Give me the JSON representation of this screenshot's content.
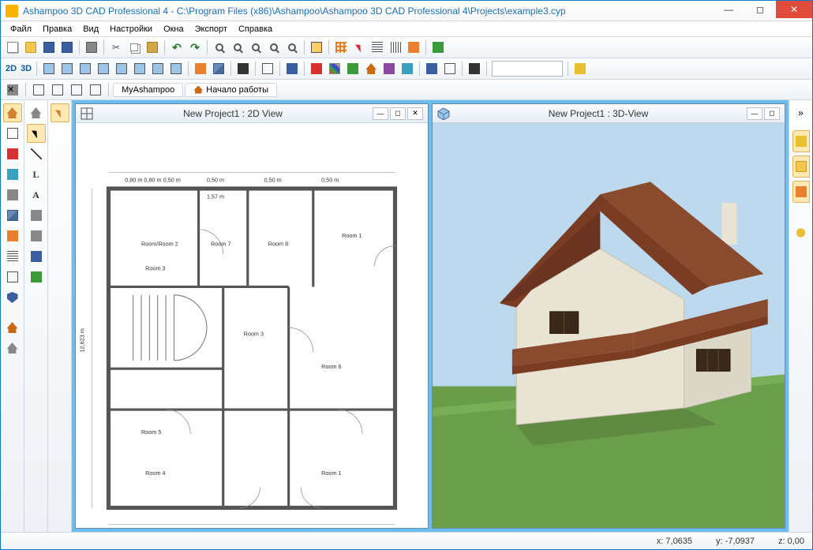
{
  "title": "Ashampoo 3D CAD Professional 4 - C:\\Program Files (x86)\\Ashampoo\\Ashampoo 3D CAD Professional 4\\Projects\\example3.cyp",
  "menu": [
    "Файл",
    "Правка",
    "Вид",
    "Настройки",
    "Окна",
    "Экспорт",
    "Справка"
  ],
  "mode_labels": {
    "d2": "2D",
    "d3": "3D"
  },
  "tabs": {
    "my": "MyAshampoo",
    "start": "Начало работы"
  },
  "panes": {
    "left_title": "New Project1 : 2D View",
    "right_title": "New Project1 : 3D-View"
  },
  "rooms": {
    "r1": "Room 1",
    "r2": "Room 2",
    "r3": "Room 3",
    "r4": "Room 4",
    "r5": "Room 5",
    "r6": "Room 6",
    "r7": "Room 7",
    "r8": "Room 8",
    "wc": "Room/Room 2"
  },
  "dims": {
    "d050_1": "0,50 m",
    "d050_2": "0,50 m",
    "d050_3": "0,50 m",
    "d050_4": "0,50 m",
    "d080": "0,80 m 0,80 m 0,50 m",
    "h12": "12,623 m",
    "t157": "1,57 m"
  },
  "status": {
    "x": "x: 7,0635",
    "y": "y: -7,0937",
    "z": "z: 0,00"
  }
}
